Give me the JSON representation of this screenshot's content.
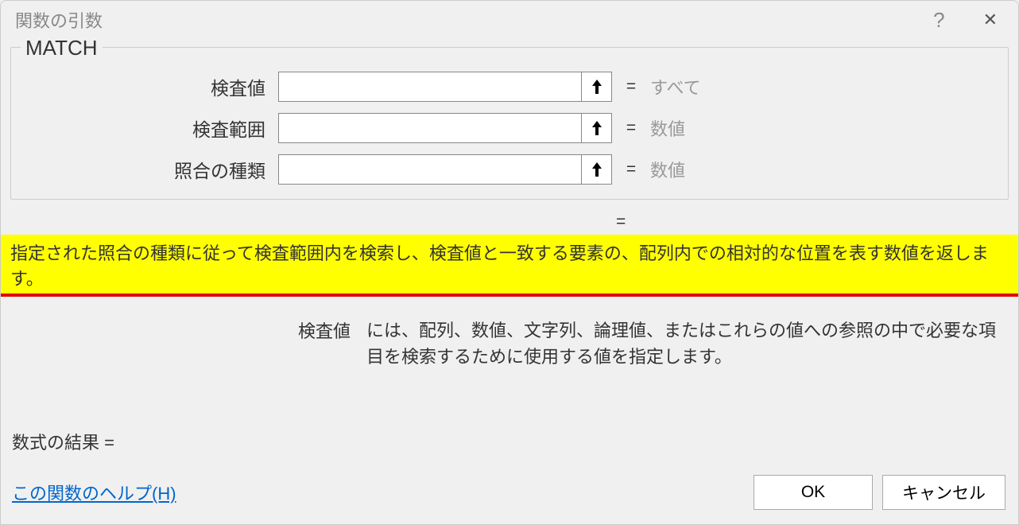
{
  "dialog": {
    "title": "関数の引数",
    "help_icon": "?",
    "close_icon": "✕"
  },
  "group": {
    "name": "MATCH",
    "args": [
      {
        "label": "検査値",
        "value": "",
        "hint": "すべて"
      },
      {
        "label": "検査範囲",
        "value": "",
        "hint": "数値"
      },
      {
        "label": "照合の種類",
        "value": "",
        "hint": "数値"
      }
    ],
    "equals": "=",
    "result_equals": "="
  },
  "description": "指定された照合の種類に従って検査範囲内を検索し、検査値と一致する要素の、配列内での相対的な位置を表す数値を返します。",
  "arg_description": {
    "label": "検査値",
    "text": "には、配列、数値、文字列、論理値、またはこれらの値への参照の中で必要な項目を検索するために使用する値を指定します。"
  },
  "formula_result": {
    "label": "数式の結果 ="
  },
  "footer": {
    "help_link": "この関数のヘルプ(H)",
    "ok": "OK",
    "cancel": "キャンセル"
  }
}
